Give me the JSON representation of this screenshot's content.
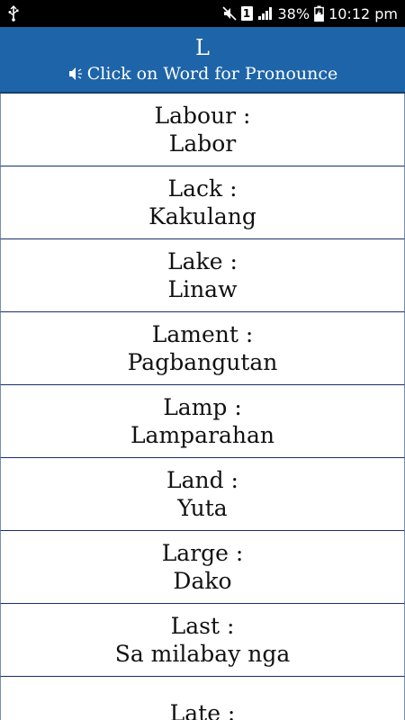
{
  "status_bar": {
    "usb_icon": "usb-icon",
    "mute_icon": "mute-icon",
    "sim_label": "1",
    "battery_percent": "38%",
    "time": "10:12 pm",
    "color": "#000000"
  },
  "header": {
    "letter": "L",
    "subtitle": "Click on Word for Pronounce",
    "speaker_icon": "speaker-icon",
    "background_color": "#1e64a8"
  },
  "words": [
    {
      "english": "Labour :",
      "translation": "Labor"
    },
    {
      "english": "Lack :",
      "translation": "Kakulang"
    },
    {
      "english": "Lake :",
      "translation": "Linaw"
    },
    {
      "english": "Lament :",
      "translation": "Pagbangutan"
    },
    {
      "english": "Lamp :",
      "translation": "Lamparahan"
    },
    {
      "english": "Land :",
      "translation": "Yuta"
    },
    {
      "english": "Large :",
      "translation": "Dako"
    },
    {
      "english": "Last :",
      "translation": "Sa milabay nga"
    },
    {
      "english": "Late :",
      "translation": ""
    }
  ]
}
